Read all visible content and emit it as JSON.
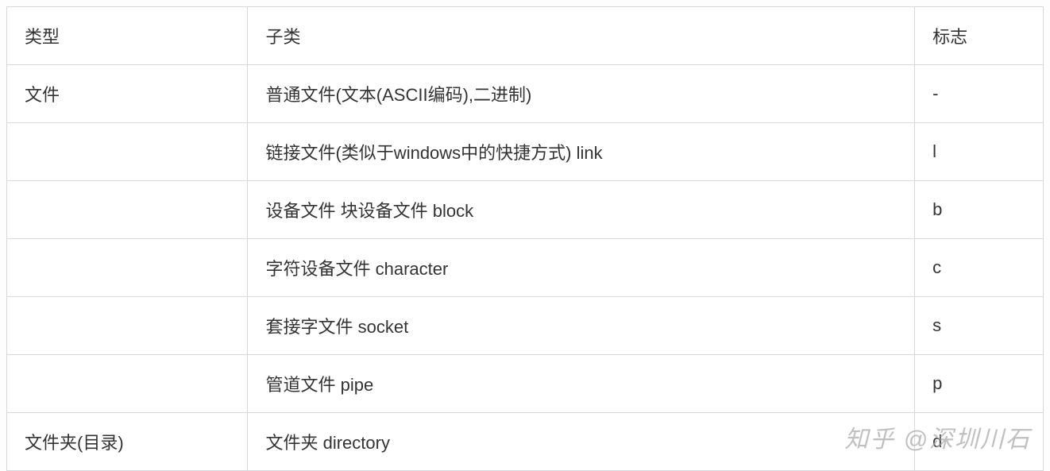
{
  "table": {
    "header": {
      "type": "类型",
      "subtype": "子类",
      "flag": "标志"
    },
    "rows": [
      {
        "type": "文件",
        "subtype": "普通文件(文本(ASCII编码),二进制)",
        "flag": "-"
      },
      {
        "type": "",
        "subtype": "链接文件(类似于windows中的快捷方式) link",
        "flag": "l"
      },
      {
        "type": "",
        "subtype": "设备文件  块设备文件 block",
        "flag": "b"
      },
      {
        "type": "",
        "subtype": "字符设备文件 character",
        "flag": "c"
      },
      {
        "type": "",
        "subtype": "套接字文件  socket",
        "flag": "s"
      },
      {
        "type": "",
        "subtype": "管道文件    pipe",
        "flag": "p"
      },
      {
        "type": "文件夹(目录)",
        "subtype": "文件夹 directory",
        "flag": "d"
      }
    ]
  },
  "watermark": "知乎 @深圳川石"
}
